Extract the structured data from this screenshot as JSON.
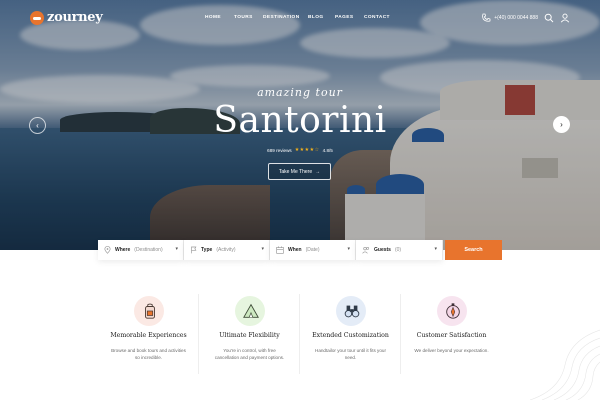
{
  "brand": {
    "name": "zourney",
    "accent": "#e8742d"
  },
  "nav": {
    "items": [
      "HOME",
      "TOURS",
      "DESTINATION",
      "BLOG",
      "PAGES",
      "CONTACT"
    ],
    "phone": "+(40) 000 0044 888",
    "search_icon": "search-icon",
    "user_icon": "user-icon"
  },
  "hero": {
    "subtitle": "amazing tour",
    "title": "Santorini",
    "reviews": "689 reviews",
    "rating": "4.8/5",
    "stars": "★★★★☆",
    "cta": "Take Me There",
    "cta_arrow": "→",
    "prev": "‹",
    "next": "›"
  },
  "search": {
    "fields": [
      {
        "label": "Where",
        "placeholder": "(Destination)",
        "icon": "pin-icon"
      },
      {
        "label": "Type",
        "placeholder": "(Activity)",
        "icon": "flag-icon"
      },
      {
        "label": "When",
        "placeholder": "(Date)",
        "icon": "calendar-icon"
      },
      {
        "label": "Guests",
        "placeholder": "(0)",
        "icon": "users-icon"
      }
    ],
    "button": "Search"
  },
  "features": [
    {
      "title": "Memorable Experiences",
      "desc": "Browse and book tours and activities so incredible.",
      "icon": "backpack-icon",
      "bg": "#fbe9e4"
    },
    {
      "title": "Ultimate Flexibility",
      "desc": "You're in control, with free cancellation and payment options.",
      "icon": "tent-icon",
      "bg": "#e6f5df"
    },
    {
      "title": "Extended Customization",
      "desc": "Handtailor your tour until it fits your need.",
      "icon": "binoculars-icon",
      "bg": "#e4ecf7"
    },
    {
      "title": "Customer Satisfaction",
      "desc": "We deliver beyond your expectation.",
      "icon": "compass-icon",
      "bg": "#f7e4ef"
    }
  ]
}
